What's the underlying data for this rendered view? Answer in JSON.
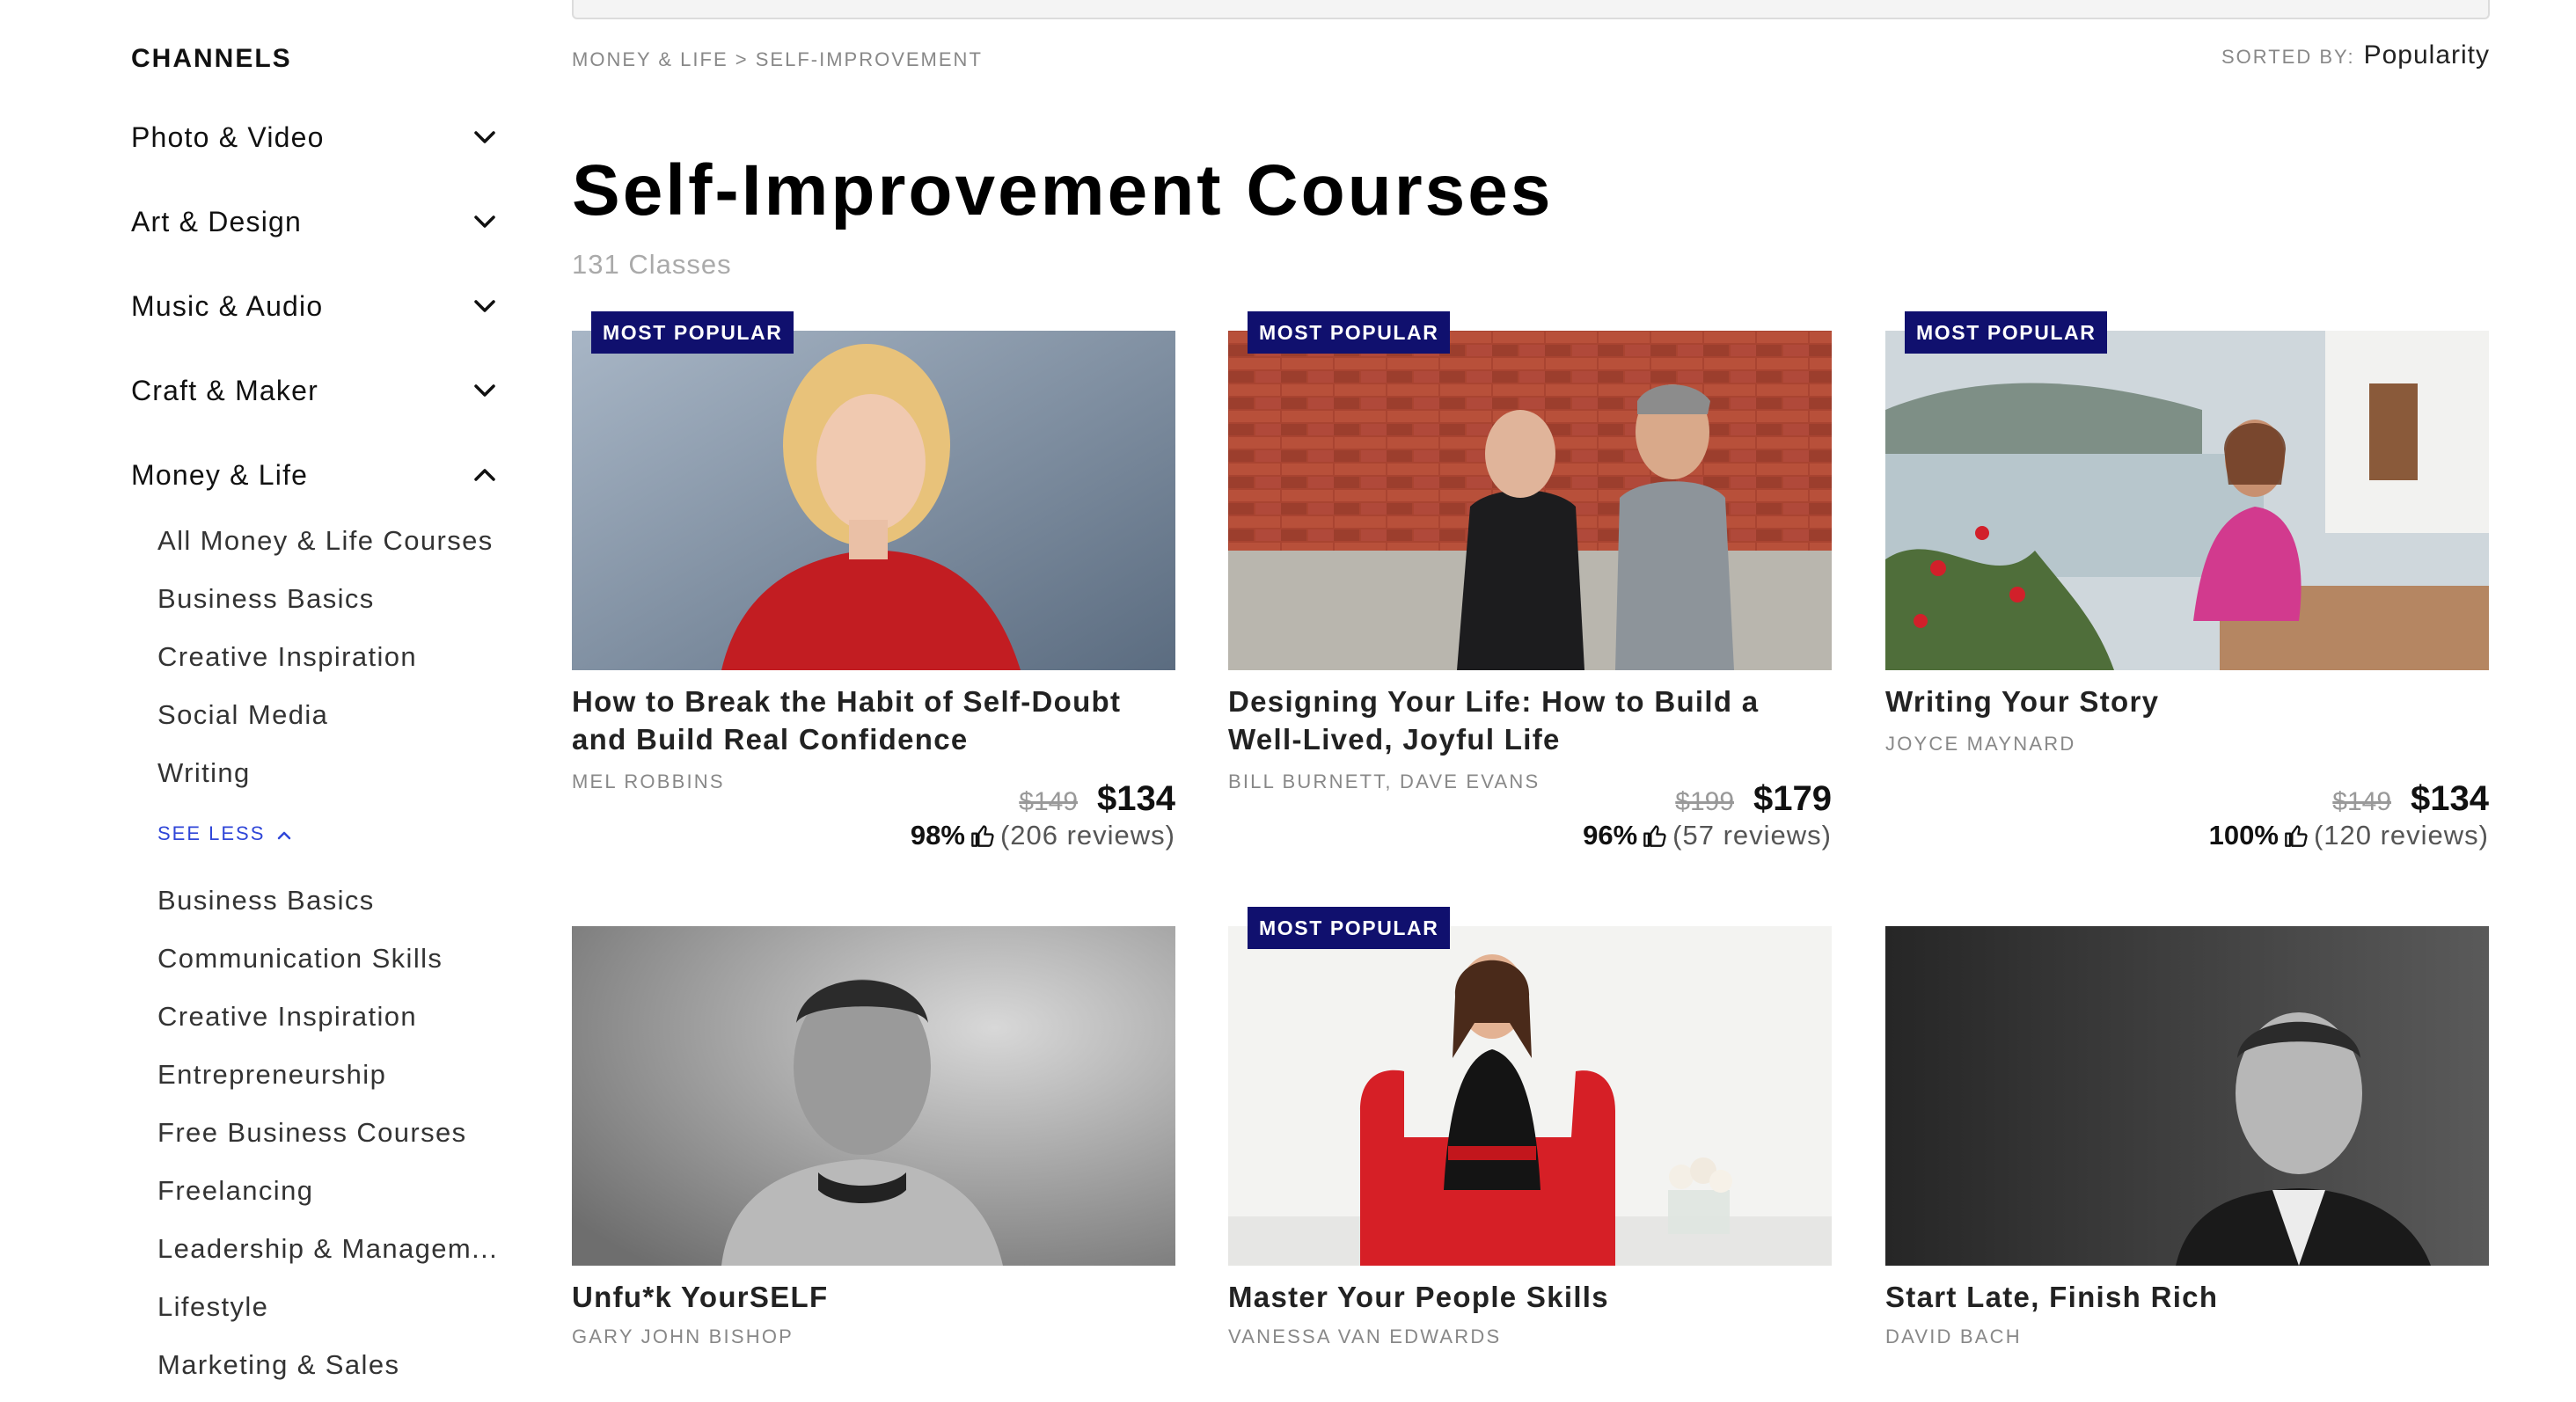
{
  "sidebar": {
    "channels_title": "CHANNELS",
    "channels": [
      {
        "label": "Photo & Video",
        "expanded": false
      },
      {
        "label": "Art & Design",
        "expanded": false
      },
      {
        "label": "Music & Audio",
        "expanded": false
      },
      {
        "label": "Craft & Maker",
        "expanded": false
      },
      {
        "label": "Money & Life",
        "expanded": true
      }
    ],
    "money_life_items": [
      "All Money & Life Courses",
      "Business Basics",
      "Creative Inspiration",
      "Social Media",
      "Writing"
    ],
    "see_less_label": "SEE LESS",
    "more_items": [
      "Business Basics",
      "Communication Skills",
      "Creative Inspiration",
      "Entrepreneurship",
      "Free Business Courses",
      "Freelancing",
      "Leadership & Managem...",
      "Lifestyle",
      "Marketing & Sales"
    ]
  },
  "breadcrumb": {
    "parent": "MONEY & LIFE",
    "separator": ">",
    "current": "SELF-IMPROVEMENT"
  },
  "sort": {
    "label": "SORTED BY:",
    "value": "Popularity"
  },
  "page": {
    "title": "Self-Improvement Courses",
    "count": "131 Classes"
  },
  "badge_label": "MOST POPULAR",
  "courses": [
    {
      "title": "How to Break the Habit of Self-Doubt and Build Real Confidence",
      "instructor": "MEL ROBBINS",
      "badge": true,
      "old_price": "$149",
      "price": "$134",
      "rating": "98%",
      "reviews": "(206 reviews)"
    },
    {
      "title": "Designing Your Life: How to Build a Well-Lived, Joyful Life",
      "instructor": "BILL BURNETT, DAVE EVANS",
      "badge": true,
      "old_price": "$199",
      "price": "$179",
      "rating": "96%",
      "reviews": "(57 reviews)"
    },
    {
      "title": "Writing Your Story",
      "instructor": "JOYCE MAYNARD",
      "badge": true,
      "old_price": "$149",
      "price": "$134",
      "rating": "100%",
      "reviews": "(120 reviews)"
    },
    {
      "title": "Unfu*k YourSELF",
      "instructor": "GARY JOHN BISHOP",
      "badge": false
    },
    {
      "title": "Master Your People Skills",
      "instructor": "VANESSA VAN EDWARDS",
      "badge": true
    },
    {
      "title": "Start Late, Finish Rich",
      "instructor": "DAVID BACH",
      "badge": false
    }
  ],
  "colors": {
    "badge_bg": "#10106e",
    "link_blue": "#2f46d8",
    "muted_text": "#888888"
  },
  "icons": [
    "chevron-down-icon",
    "chevron-up-icon",
    "thumbs-up-icon"
  ]
}
